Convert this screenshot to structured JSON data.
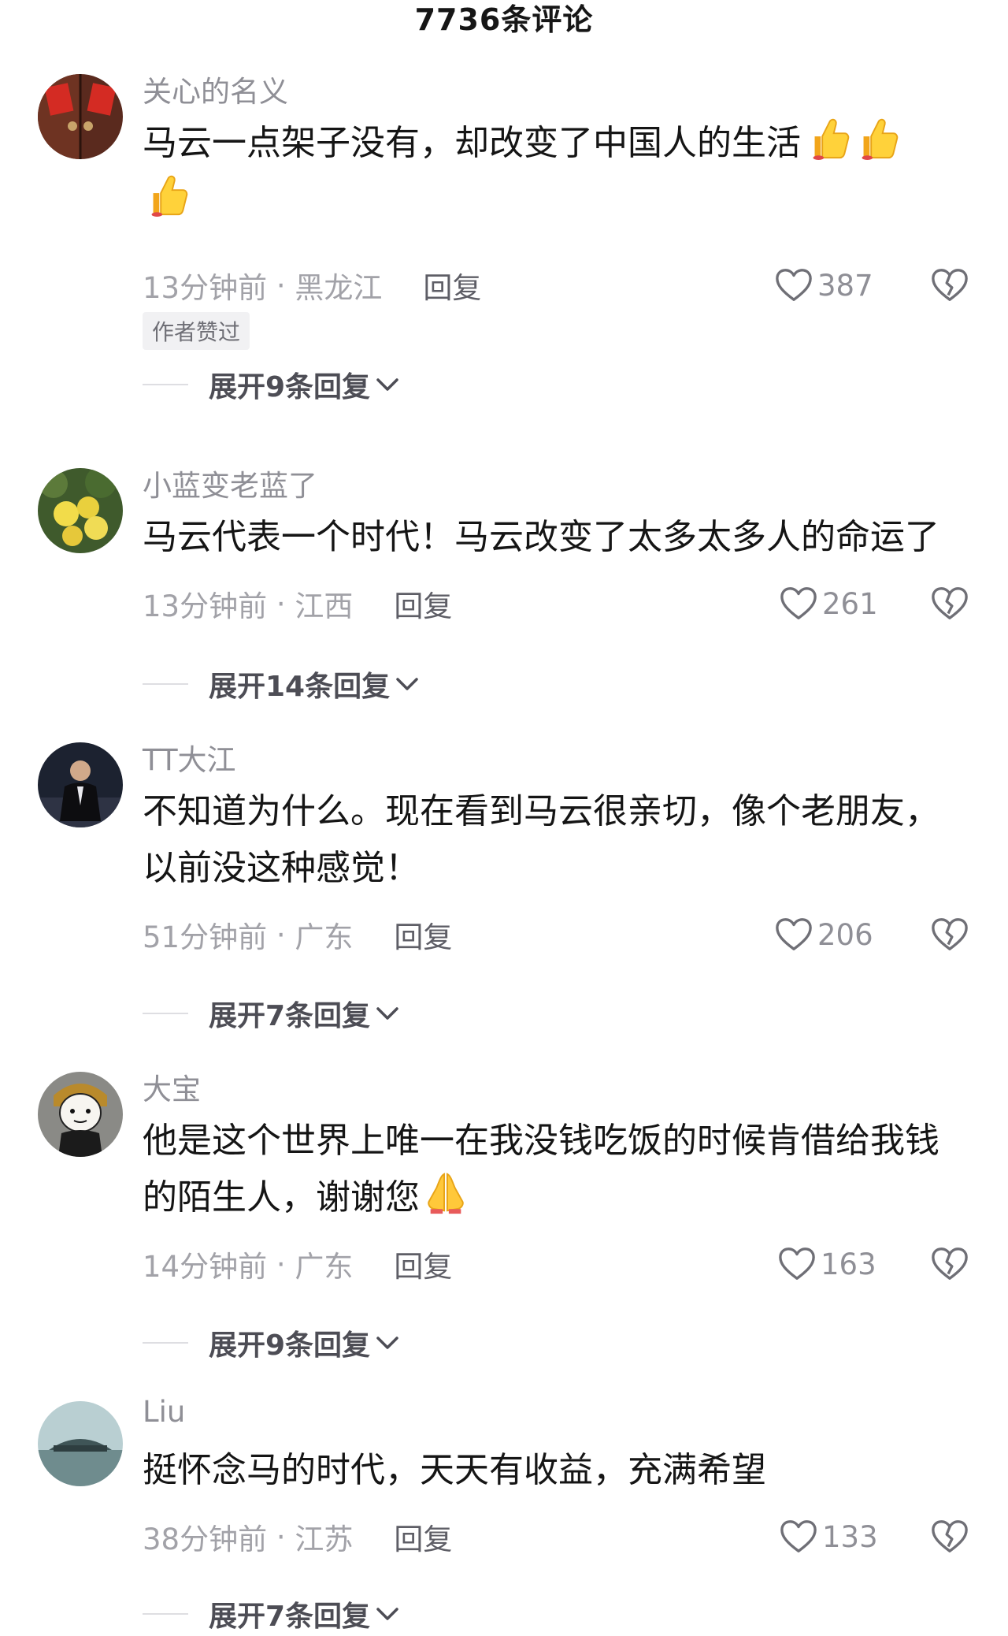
{
  "header": {
    "title": "7736条评论"
  },
  "comments": [
    {
      "username": "关心的名义",
      "text": "马云一点架子没有，却改变了中国人的生活",
      "emojis": [
        "thumbs-up",
        "thumbs-up",
        "thumbs-up"
      ],
      "time": "13分钟前",
      "location": "黑龙江",
      "reply_label": "回复",
      "likes": "387",
      "author_badge": "作者赞过",
      "expand_label": "展开9条回复"
    },
    {
      "username": "小蓝变老蓝了",
      "text": "马云代表一个时代！马云改变了太多太多人的命运了",
      "time": "13分钟前",
      "location": "江西",
      "reply_label": "回复",
      "likes": "261",
      "expand_label": "展开14条回复"
    },
    {
      "username": "TT大江",
      "text": "不知道为什么。现在看到马云很亲切，像个老朋友，以前没这种感觉！",
      "time": "51分钟前",
      "location": "广东",
      "reply_label": "回复",
      "likes": "206",
      "expand_label": "展开7条回复"
    },
    {
      "username": "大宝",
      "text": "他是这个世界上唯一在我没钱吃饭的时候肯借给我钱的陌生人，谢谢您",
      "emojis": [
        "folded-hands"
      ],
      "time": "14分钟前",
      "location": "广东",
      "reply_label": "回复",
      "likes": "163",
      "expand_label": "展开9条回复"
    },
    {
      "username": "Liu",
      "text": "挺怀念马的时代，天天有收益，充满希望",
      "time": "38分钟前",
      "location": "江苏",
      "reply_label": "回复",
      "likes": "133",
      "expand_label": "展开7条回复"
    }
  ],
  "colors": {
    "username": "#8f8f96",
    "meta": "#a2a2a8",
    "reply": "#5e5e66",
    "expand": "#4d4d55"
  }
}
